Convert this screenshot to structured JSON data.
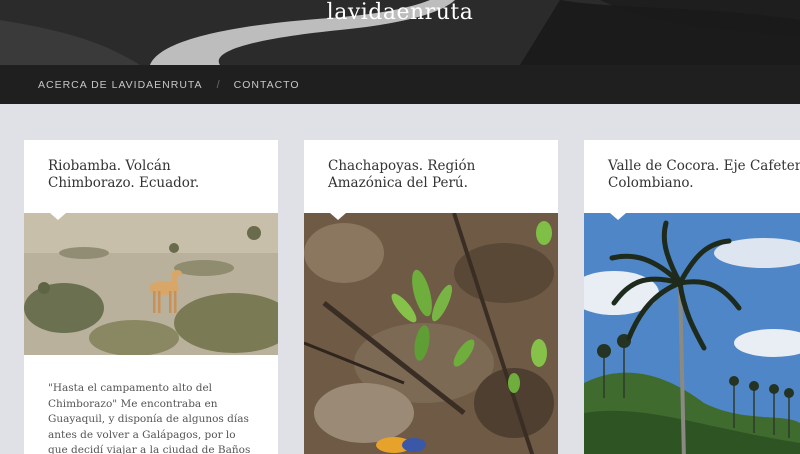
{
  "site": {
    "title": "lavidaenruta"
  },
  "nav": {
    "items": [
      {
        "label": "ACERCA DE LAVIDAENRUTA"
      },
      {
        "label": "CONTACTO"
      }
    ],
    "separator": "/"
  },
  "posts": [
    {
      "title": "Riobamba. Volcán Chimborazo. Ecuador.",
      "image_icon": "vicuna-photo",
      "excerpt": "\"Hasta el campamento alto del Chimborazo\" Me encontraba en Guayaquil, y disponía de algunos días antes de volver a Galápagos, por lo que decidí viajar a la ciudad de Baños y"
    },
    {
      "title": "Chachapoyas. Región Amazónica del Perú.",
      "image_icon": "forest-floor-photo",
      "excerpt": ""
    },
    {
      "title": "Valle de Cocora. Eje Cafetero Colombiano.",
      "image_icon": "wax-palm-photo",
      "excerpt": ""
    }
  ],
  "colors": {
    "header_bg": "#2e2e2e",
    "nav_bg": "#1f1f1f",
    "page_bg": "#dfe1e6",
    "card_bg": "#ffffff"
  }
}
